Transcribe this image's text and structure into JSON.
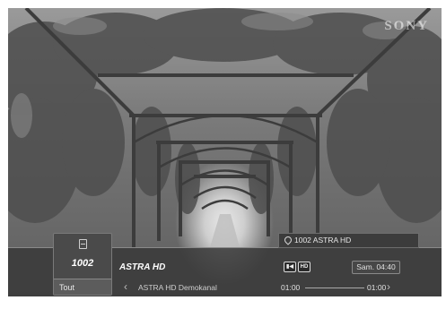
{
  "brand": "SONY",
  "channel": {
    "number": "1002",
    "list_filter": "Tout",
    "name": "ASTRA HD",
    "list_icon": "list-icon"
  },
  "program_tag": {
    "icon": "location-pin-icon",
    "label": "1002 ASTRA HD"
  },
  "badges": [
    {
      "icon": "subtitle-icon",
      "text": "▮◀"
    },
    {
      "icon": "hd-icon",
      "text": "HD"
    }
  ],
  "datetime": "Sam. 04:40",
  "event": {
    "title": "ASTRA HD Demokanal",
    "start": "01:00",
    "end": "01:00",
    "progress": 0
  },
  "nav": {
    "prev_icon": "chevron-left-icon",
    "next_icon": "chevron-right-icon"
  }
}
